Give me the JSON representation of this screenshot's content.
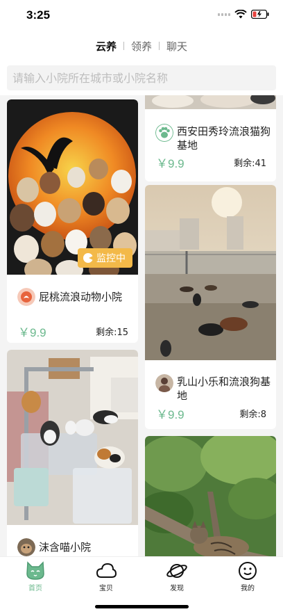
{
  "status": {
    "time": "3:25"
  },
  "tabs": [
    {
      "label": "云养",
      "active": true
    },
    {
      "label": "领养",
      "active": false
    },
    {
      "label": "聊天",
      "active": false
    }
  ],
  "search": {
    "placeholder": "请输入小院所在城市或小院名称"
  },
  "cards": [
    {
      "title": "屁桃流浪动物小院",
      "price": "￥9.9",
      "remaining": "剩余:15",
      "badge": "监控中"
    },
    {
      "title": "沫含喵小院"
    },
    {
      "title": "西安田秀玲流浪猫狗基地",
      "price": "￥9.9",
      "remaining": "剩余:41"
    },
    {
      "title": "乳山小乐和流浪狗基地",
      "price": "￥9.9",
      "remaining": "剩余:8"
    }
  ],
  "tabbar": [
    {
      "label": "首页",
      "icon": "cat-face-icon",
      "active": true
    },
    {
      "label": "宝贝",
      "icon": "cloud-icon",
      "active": false
    },
    {
      "label": "发现",
      "icon": "planet-icon",
      "active": false
    },
    {
      "label": "我的",
      "icon": "smiley-icon",
      "active": false
    }
  ],
  "colors": {
    "accent": "#6cb98e",
    "badge": "#f3b949",
    "background": "#f4f4f4"
  }
}
